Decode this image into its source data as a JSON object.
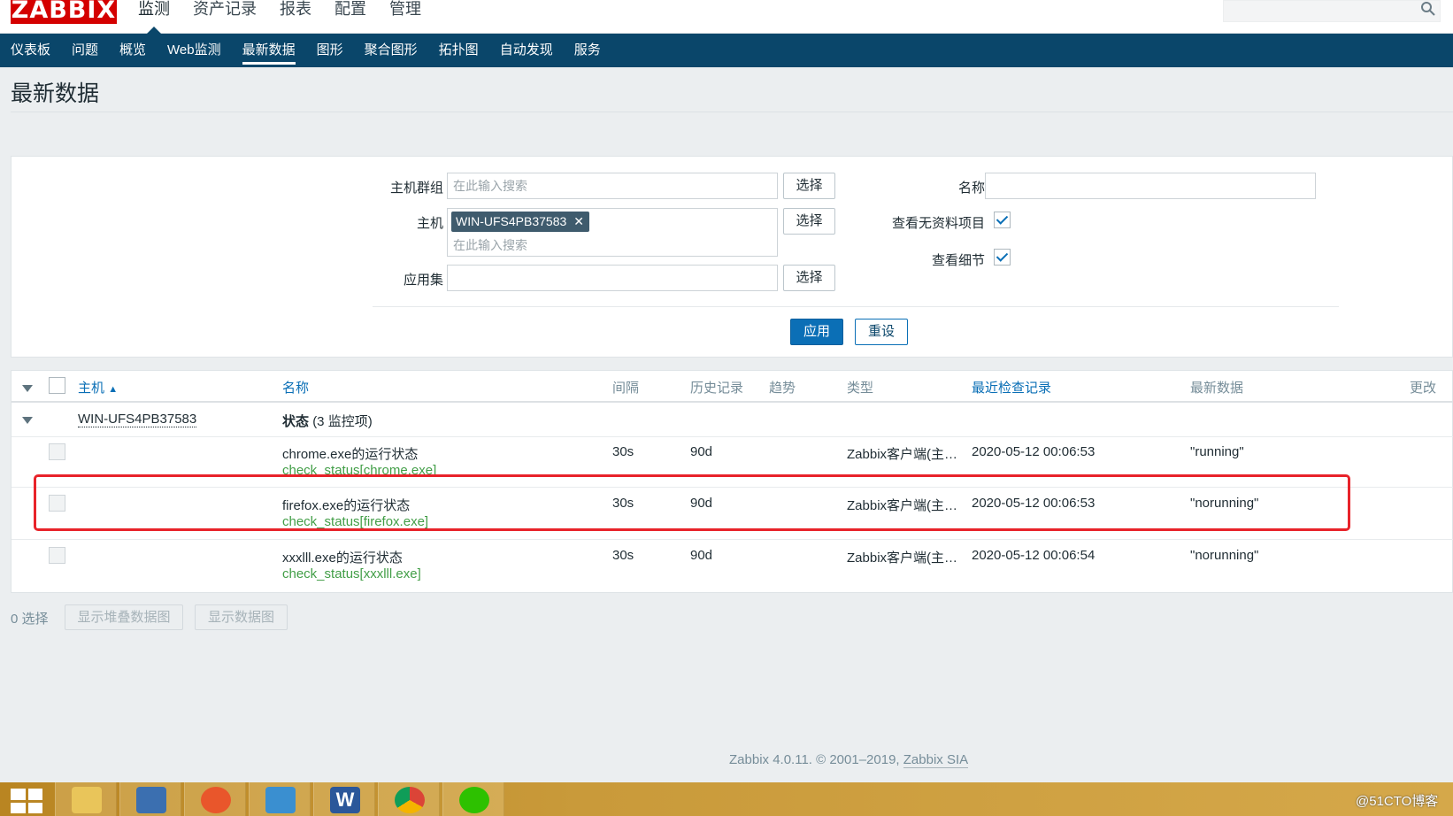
{
  "brand": "ZABBIX",
  "main_menu": [
    "监测",
    "资产记录",
    "报表",
    "配置",
    "管理"
  ],
  "sub_menu": [
    "仪表板",
    "问题",
    "概览",
    "Web监测",
    "最新数据",
    "图形",
    "聚合图形",
    "拓扑图",
    "自动发现",
    "服务"
  ],
  "page_title": "最新数据",
  "filter": {
    "host_group_label": "主机群组",
    "host_group_placeholder": "在此输入搜索",
    "host_label": "主机",
    "host_tag": "WIN-UFS4PB37583",
    "host_placeholder": "在此输入搜索",
    "application_label": "应用集",
    "select_label": "选择",
    "name_label": "名称",
    "name_value": "",
    "show_no_data_label": "查看无资料项目",
    "show_no_data_checked": true,
    "show_details_label": "查看细节",
    "show_details_checked": true,
    "apply_label": "应用",
    "reset_label": "重设"
  },
  "table": {
    "headers": {
      "host": "主机",
      "name": "名称",
      "interval": "间隔",
      "history": "历史记录",
      "trends": "趋势",
      "type": "类型",
      "last_check": "最近检查记录",
      "last_value": "最新数据",
      "change": "更改"
    },
    "group": {
      "host": "WIN-UFS4PB37583",
      "app_name": "状态",
      "app_count": "(3 监控项)"
    },
    "rows": [
      {
        "name": "chrome.exe的运行状态",
        "key": "check_status[chrome.exe]",
        "interval": "30s",
        "history": "90d",
        "type": "Zabbix客户端(主…",
        "last_check": "2020-05-12 00:06:53",
        "last_value": "\"running\""
      },
      {
        "name": "firefox.exe的运行状态",
        "key": "check_status[firefox.exe]",
        "interval": "30s",
        "history": "90d",
        "type": "Zabbix客户端(主…",
        "last_check": "2020-05-12 00:06:53",
        "last_value": "\"norunning\""
      },
      {
        "name": "xxxlll.exe的运行状态",
        "key": "check_status[xxxlll.exe]",
        "interval": "30s",
        "history": "90d",
        "type": "Zabbix客户端(主…",
        "last_check": "2020-05-12 00:06:54",
        "last_value": "\"norunning\""
      }
    ]
  },
  "footer": {
    "selected": "0 选择",
    "stacked_graph_label": "显示堆叠数据图",
    "graph_label": "显示数据图",
    "copyright_text": "Zabbix 4.0.11. © 2001–2019,",
    "copyright_link": "Zabbix SIA"
  },
  "taskbar": {
    "watermark": "@51CTO博客"
  },
  "colors": {
    "brand_red": "#d40000",
    "nav_blue": "#0a466a",
    "accent_blue": "#0b6fb6",
    "key_green": "#429e47",
    "highlight_red": "#e8232a"
  }
}
